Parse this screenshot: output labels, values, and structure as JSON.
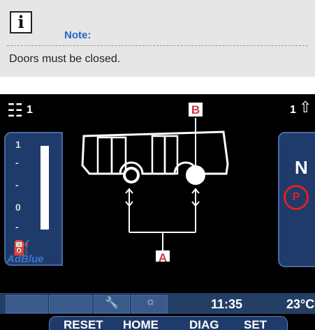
{
  "note": {
    "icon": "info-icon",
    "icon_glyph": "i",
    "title": "Note:",
    "text": "Doors must be closed."
  },
  "display": {
    "left_top_num": "1",
    "right_top_num": "1",
    "gauge_top": "1",
    "gauge_mid": "0",
    "adblue": "AdBlue",
    "gear": "N",
    "park": "P",
    "labels": {
      "A": "A",
      "B": "B"
    },
    "time": "11:35",
    "temp": "23°C",
    "menu": [
      "RESET",
      "HOME",
      "DIAG",
      "SET"
    ]
  },
  "colors": {
    "accent_blue": "#1f67c4",
    "panel_blue": "#1f3b6b",
    "label_red": "#d23a3a"
  }
}
